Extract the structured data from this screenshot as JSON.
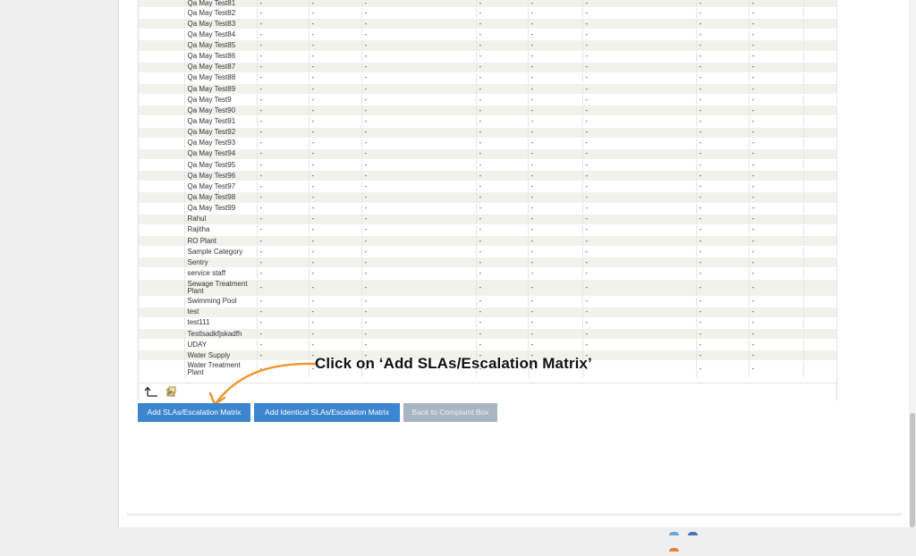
{
  "table": {
    "rows": [
      {
        "name": "Qa May Test81",
        "cells": [
          "-",
          "-",
          "-",
          "-",
          "-",
          "-",
          "-",
          "-"
        ]
      },
      {
        "name": "Qa May Test82",
        "cells": [
          "-",
          "-",
          "-",
          "-",
          "-",
          "-",
          "-",
          "-"
        ]
      },
      {
        "name": "Qa May Test83",
        "cells": [
          "-",
          "-",
          "-",
          "-",
          "-",
          "-",
          "-",
          "-"
        ]
      },
      {
        "name": "Qa May Test84",
        "cells": [
          "-",
          "-",
          "-",
          "-",
          "-",
          "-",
          "-",
          "-"
        ]
      },
      {
        "name": "Qa May Test85",
        "cells": [
          "-",
          "-",
          "-",
          "-",
          "-",
          "-",
          "-",
          "-"
        ]
      },
      {
        "name": "Qa May Test86",
        "cells": [
          "-",
          "-",
          "-",
          "-",
          "-",
          "-",
          "-",
          "-"
        ]
      },
      {
        "name": "Qa May Test87",
        "cells": [
          "-",
          "-",
          "-",
          "-",
          "-",
          "-",
          "-",
          "-"
        ]
      },
      {
        "name": "Qa May Test88",
        "cells": [
          "-",
          "-",
          "-",
          "-",
          "-",
          "-",
          "-",
          "-"
        ]
      },
      {
        "name": "Qa May Test89",
        "cells": [
          "-",
          "-",
          "-",
          "-",
          "-",
          "-",
          "-",
          "-"
        ]
      },
      {
        "name": "Qa May Test9",
        "cells": [
          "-",
          "-",
          "-",
          "-",
          "-",
          "-",
          "-",
          "-"
        ]
      },
      {
        "name": "Qa May Test90",
        "cells": [
          "-",
          "-",
          "-",
          "-",
          "-",
          "-",
          "-",
          "-"
        ]
      },
      {
        "name": "Qa May Test91",
        "cells": [
          "-",
          "-",
          "-",
          "-",
          "-",
          "-",
          "-",
          "-"
        ]
      },
      {
        "name": "Qa May Test92",
        "cells": [
          "-",
          "-",
          "-",
          "-",
          "-",
          "-",
          "-",
          "-"
        ]
      },
      {
        "name": "Qa May Test93",
        "cells": [
          "-",
          "-",
          "-",
          "-",
          "-",
          "-",
          "-",
          "-"
        ]
      },
      {
        "name": "Qa May Test94",
        "cells": [
          "-",
          "-",
          "-",
          "-",
          "-",
          "-",
          "-",
          "-"
        ]
      },
      {
        "name": "Qa May Test95",
        "cells": [
          "-",
          "-",
          "-",
          "-",
          "-",
          "-",
          "-",
          "-"
        ]
      },
      {
        "name": "Qa May Test96",
        "cells": [
          "-",
          "-",
          "-",
          "-",
          "-",
          "-",
          "-",
          "-"
        ]
      },
      {
        "name": "Qa May Test97",
        "cells": [
          "-",
          "-",
          "-",
          "-",
          "-",
          "-",
          "-",
          "-"
        ]
      },
      {
        "name": "Qa May Test98",
        "cells": [
          "-",
          "-",
          "-",
          "-",
          "-",
          "-",
          "-",
          "-"
        ]
      },
      {
        "name": "Qa May Test99",
        "cells": [
          "-",
          "-",
          "-",
          "-",
          "-",
          "-",
          "-",
          "-"
        ]
      },
      {
        "name": "Rahul",
        "cells": [
          "-",
          "-",
          "-",
          "-",
          "-",
          "-",
          "-",
          "-"
        ]
      },
      {
        "name": "Rajitha",
        "cells": [
          "-",
          "-",
          "-",
          "-",
          "-",
          "-",
          "-",
          "-"
        ]
      },
      {
        "name": "RO Plant",
        "cells": [
          "-",
          "-",
          "-",
          "-",
          "-",
          "-",
          "-",
          "-"
        ]
      },
      {
        "name": "Sample Category",
        "cells": [
          "-",
          "-",
          "-",
          "-",
          "-",
          "-",
          "-",
          "-"
        ]
      },
      {
        "name": "Sentry",
        "cells": [
          "-",
          "-",
          "-",
          "-",
          "-",
          "-",
          "-",
          "-"
        ]
      },
      {
        "name": "service staff",
        "cells": [
          "-",
          "-",
          "-",
          "-",
          "-",
          "-",
          "-",
          "-"
        ]
      },
      {
        "name": "Sewage Treatment Plant",
        "cells": [
          "-",
          "-",
          "-",
          "-",
          "-",
          "-",
          "-",
          "-"
        ],
        "tall": true
      },
      {
        "name": "Swimming Pool",
        "cells": [
          "-",
          "-",
          "-",
          "-",
          "-",
          "-",
          "-",
          "-"
        ]
      },
      {
        "name": "test",
        "cells": [
          "-",
          "-",
          "-",
          "-",
          "-",
          "-",
          "-",
          "-"
        ]
      },
      {
        "name": "test111",
        "cells": [
          "-",
          "-",
          "-",
          "-",
          "-",
          "-",
          "-",
          "-"
        ]
      },
      {
        "name": "Testlsadkfjskadfh",
        "cells": [
          "-",
          "-",
          "-",
          "-",
          "-",
          "-",
          "-",
          "-"
        ]
      },
      {
        "name": "UDAY",
        "cells": [
          "-",
          "-",
          "-",
          "-",
          "-",
          "-",
          "-",
          "-"
        ]
      },
      {
        "name": "Water Supply",
        "cells": [
          "-",
          "-",
          "-",
          "-",
          "-",
          "-",
          "-",
          "-"
        ]
      },
      {
        "name": "Water Treatment Plant",
        "cells": [
          "-",
          "-",
          "-",
          "-",
          "-",
          "-",
          "-",
          "-"
        ],
        "tall": true
      }
    ]
  },
  "buttons": {
    "add_sla": "Add SLAs/Escalation Matrix",
    "add_identical_sla": "Add Identical SLAs/Escalation Matrix",
    "back": "Back to Complaint Box"
  },
  "callout": {
    "text": "Click on ‘Add SLAs/Escalation Matrix’"
  },
  "colors": {
    "button_primary": "#3b86cf",
    "button_disabled": "#a8b5c2",
    "arrow": "#f0952a",
    "row_alt": "#f2f2ed"
  },
  "icons": {
    "scroll_top": "arrow-up-left-icon",
    "export": "export-icon"
  }
}
